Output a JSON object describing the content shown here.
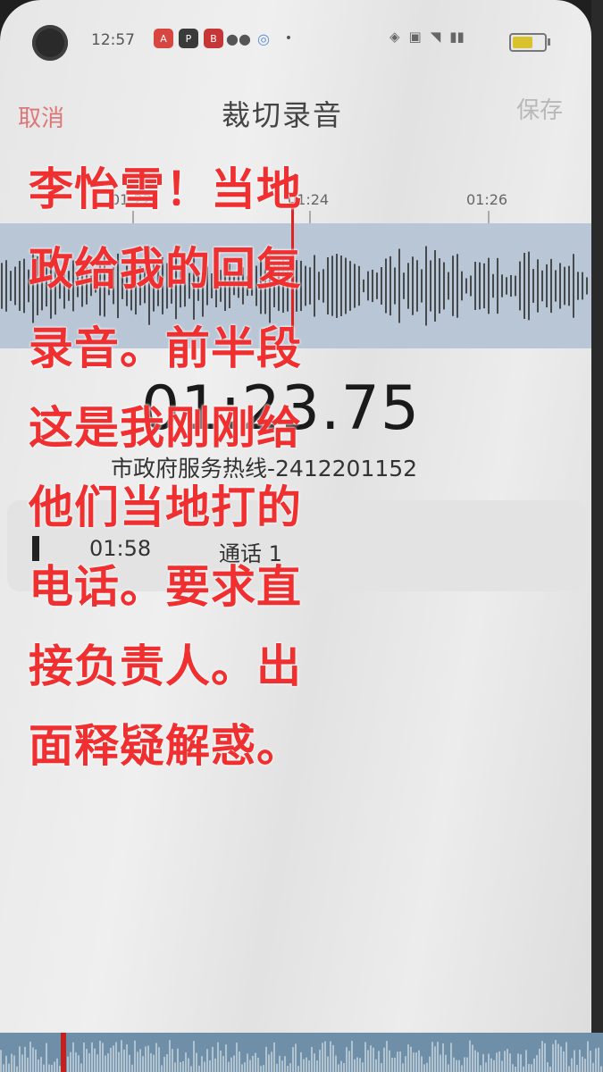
{
  "status_bar": {
    "time": "12:57",
    "app_icons": [
      {
        "name": "app-red-icon",
        "color": "#d9453f"
      },
      {
        "name": "app-dark-icon",
        "color": "#3a3a3a"
      },
      {
        "name": "app-red2-icon",
        "color": "#c73636"
      },
      {
        "name": "app-chat-icon",
        "color": "#555555"
      },
      {
        "name": "app-blue-icon",
        "color": "#5a8fd8"
      }
    ]
  },
  "header": {
    "cancel_label": "取消",
    "title": "裁切录音",
    "save_label": "保存"
  },
  "timeline": {
    "ticks": [
      "01:22",
      "01:24",
      "01:26"
    ]
  },
  "current_time": "01:23.75",
  "file_name": "市政府服务热线-2412201152",
  "clip": {
    "duration": "01:58",
    "label": "通话 1"
  },
  "overlay_lines": [
    "李怡雪！当地",
    "政给我的回复",
    "录音。前半段",
    "这是我刚刚给",
    "他们当地打的",
    "电话。要求直",
    "接负责人。出",
    "面释疑解惑。"
  ],
  "colors": {
    "accent": "#e02222",
    "overlay_text": "#f03030",
    "waveform_bg": "#b8c6d6"
  }
}
